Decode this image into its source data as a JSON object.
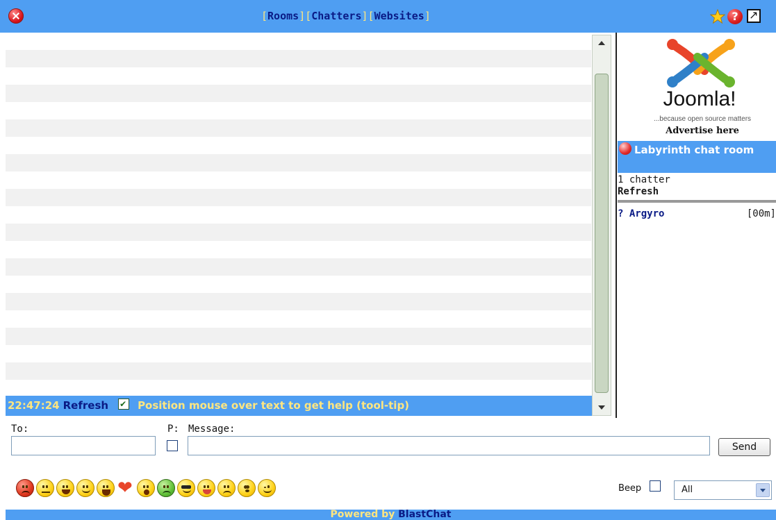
{
  "nav": {
    "open": "[",
    "close": "]",
    "rooms": "Rooms",
    "chatters": "Chatters",
    "websites": "Websites"
  },
  "header_icons": [
    "close-icon",
    "star-icon",
    "help-icon",
    "popout-icon"
  ],
  "status": {
    "time": "22:47:24",
    "refresh": "Refresh",
    "auto_refresh_checked": true,
    "help_text": "Position mouse over text to get help (tool-tip)"
  },
  "ad": {
    "brand": "Joomla!",
    "tagline": "...because open source matters",
    "label": "Advertise here"
  },
  "room": {
    "title": "Labyrinth chat room",
    "count": "1 chatter",
    "refresh": "Refresh"
  },
  "chatters": [
    {
      "name": "? Argyro",
      "time": "[00m]"
    }
  ],
  "form": {
    "to_label": "To:",
    "to_value": "",
    "private_label": "P:",
    "message_label": "Message:",
    "message_value": "",
    "send_label": "Send"
  },
  "smileys": [
    "angry",
    "neutral",
    "grin",
    "smile",
    "laugh",
    "heart",
    "surprised",
    "sick",
    "cool",
    "tongue",
    "sad",
    "dizzy",
    "wink"
  ],
  "beep_label": "Beep",
  "filter": {
    "selected": "All"
  },
  "footer": {
    "prefix": "Powered by",
    "link": "BlastChat"
  },
  "colors": {
    "bar_blue": "#4f9ef2",
    "link_navy": "#0a1b86",
    "highlight_yellow": "#ffe680"
  }
}
